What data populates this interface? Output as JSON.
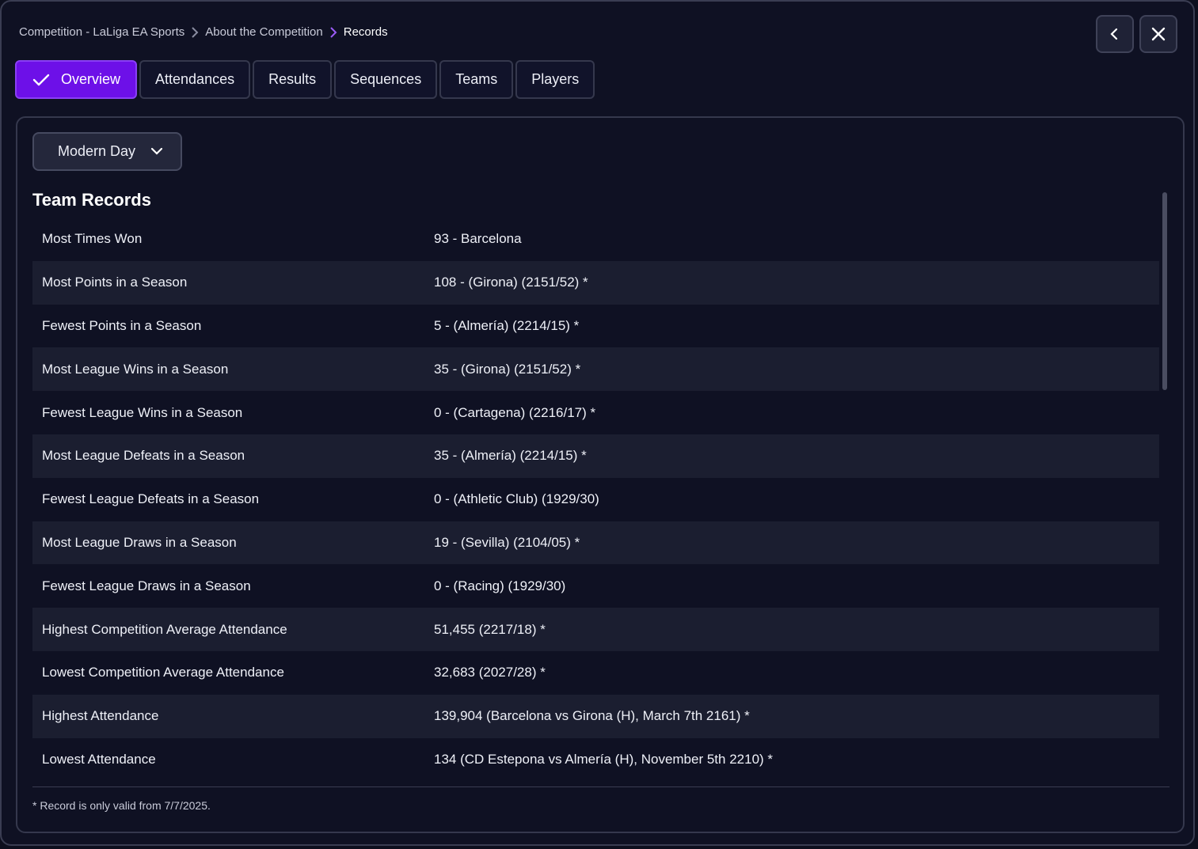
{
  "breadcrumb": {
    "items": [
      "Competition - LaLiga EA Sports",
      "About the Competition",
      "Records"
    ]
  },
  "window_buttons": {
    "back_icon": "chevron-left-icon",
    "close_icon": "close-icon"
  },
  "tabs": [
    {
      "label": "Overview",
      "active": true
    },
    {
      "label": "Attendances"
    },
    {
      "label": "Results"
    },
    {
      "label": "Sequences"
    },
    {
      "label": "Teams"
    },
    {
      "label": "Players"
    }
  ],
  "filter": {
    "selected": "Modern Day"
  },
  "section": {
    "title": "Team Records"
  },
  "records": [
    {
      "label": "Most Times Won",
      "value": "93 - Barcelona"
    },
    {
      "label": "Most Points in a Season",
      "value": "108 - (Girona) (2151/52) *"
    },
    {
      "label": "Fewest Points in a Season",
      "value": "5 - (Almería) (2214/15) *"
    },
    {
      "label": "Most League Wins in a Season",
      "value": "35 - (Girona) (2151/52) *"
    },
    {
      "label": "Fewest League Wins in a Season",
      "value": "0 - (Cartagena) (2216/17) *"
    },
    {
      "label": "Most League Defeats in a Season",
      "value": "35 - (Almería) (2214/15) *"
    },
    {
      "label": "Fewest League Defeats in a Season",
      "value": "0 - (Athletic Club) (1929/30)"
    },
    {
      "label": "Most League Draws in a Season",
      "value": "19 - (Sevilla) (2104/05) *"
    },
    {
      "label": "Fewest League Draws in a Season",
      "value": "0 - (Racing) (1929/30)"
    },
    {
      "label": "Highest Competition Average Attendance",
      "value": "51,455 (2217/18) *"
    },
    {
      "label": "Lowest Competition Average Attendance",
      "value": "32,683 (2027/28) *"
    },
    {
      "label": "Highest Attendance",
      "value": "139,904 (Barcelona vs Girona (H), March 7th 2161) *"
    },
    {
      "label": "Lowest Attendance",
      "value": "134 (CD Estepona vs Almería (H), November 5th 2210) *"
    }
  ],
  "footnote": "* Record is only valid from 7/7/2025.",
  "colors": {
    "accent": "#6d10e8",
    "background": "#0f1123",
    "row_alt": "#1b1e30"
  }
}
